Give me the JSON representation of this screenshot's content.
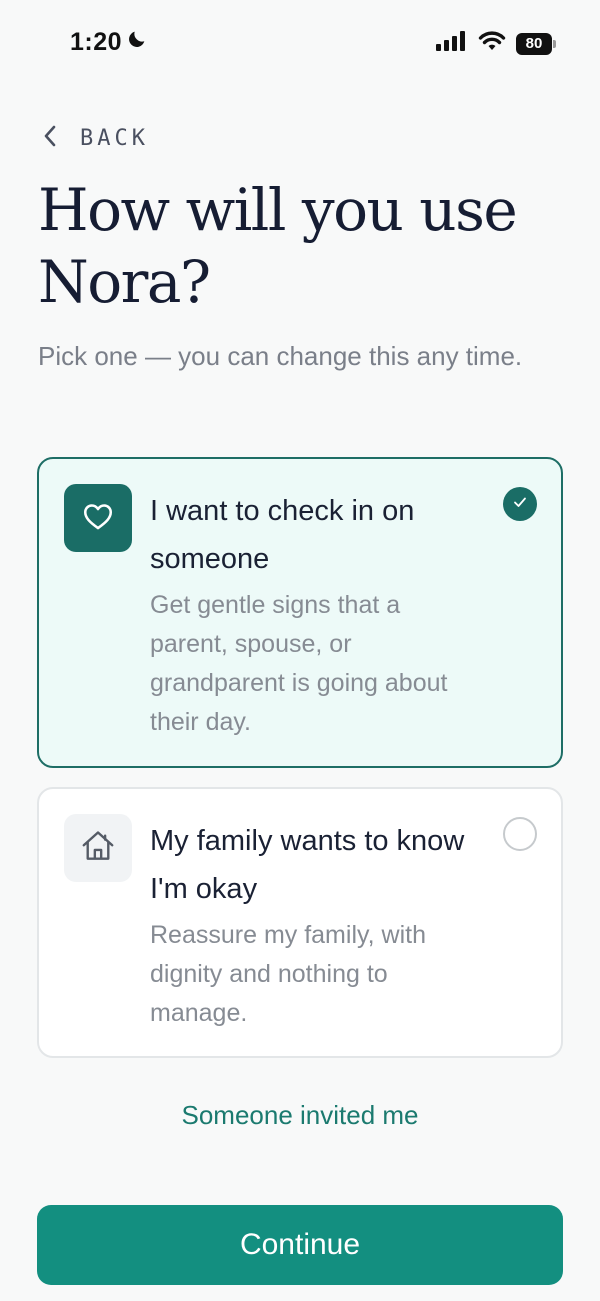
{
  "status_bar": {
    "time": "1:20",
    "battery": "80",
    "icons": [
      "moon-icon",
      "signal-icon",
      "wifi-icon",
      "battery-icon"
    ]
  },
  "nav": {
    "back_label": "BACK",
    "back_icon": "chevron-left-icon"
  },
  "header": {
    "title": "How will you use Nora?",
    "subtitle": "Pick one — you can change this any time."
  },
  "options": [
    {
      "title": "I want to check in on someone",
      "description": "Get gentle signs that a parent, spouse, or grandparent is going about their day.",
      "icon": "heart-icon",
      "selected": true
    },
    {
      "title": "My family wants to know I'm okay",
      "description": "Reassure my family, with dignity and nothing to manage.",
      "icon": "home-icon",
      "selected": false
    }
  ],
  "invite_link": "Someone invited me",
  "continue_label": "Continue",
  "colors": {
    "accent": "#1a6d66",
    "button": "#138f80",
    "selected_bg": "#edfaf8",
    "link": "#1b7a6f"
  }
}
